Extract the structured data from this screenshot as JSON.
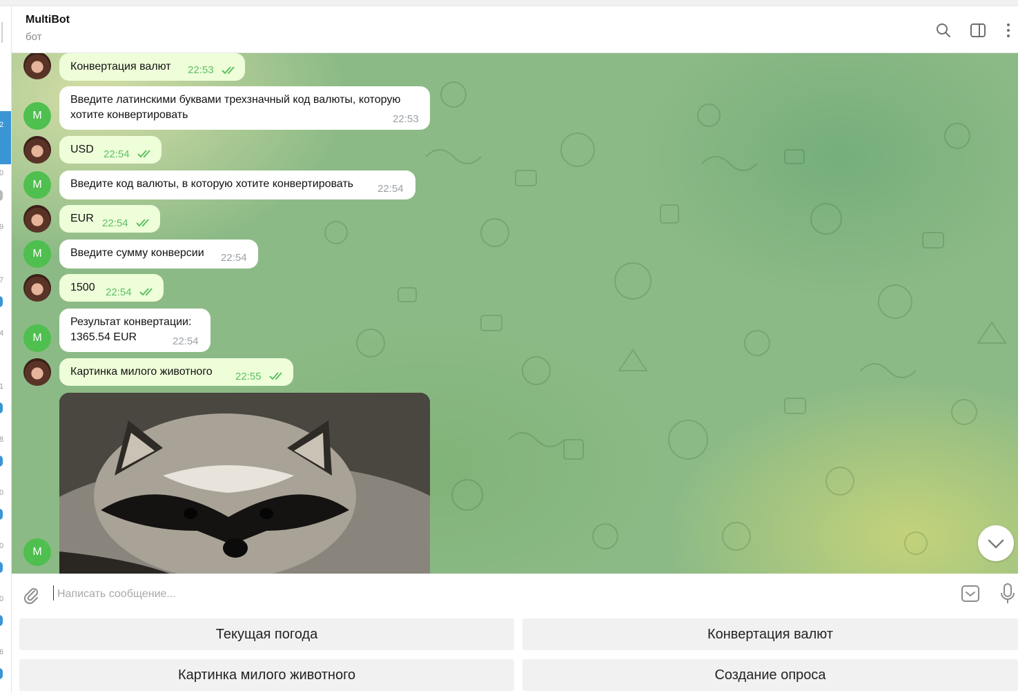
{
  "header": {
    "title": "MultiBot",
    "subtitle": "бот"
  },
  "left_strip": {
    "numbers": [
      "2",
      "0",
      "9",
      "7",
      "4",
      "1",
      "8",
      "0",
      "0",
      "0",
      "6"
    ]
  },
  "messages": [
    {
      "from": "user",
      "text": "Конвертация валют",
      "time": "22:53"
    },
    {
      "from": "bot",
      "avatar_letter": "M",
      "lines": [
        "Введите латинскими буквами трехзначный код валюты, которую",
        "хотите конвертировать"
      ],
      "time": "22:53"
    },
    {
      "from": "user",
      "text": "USD",
      "time": "22:54"
    },
    {
      "from": "bot",
      "avatar_letter": "M",
      "text": "Введите код валюты, в которую хотите конвертировать",
      "time": "22:54"
    },
    {
      "from": "user",
      "text": "EUR",
      "time": "22:54"
    },
    {
      "from": "bot",
      "avatar_letter": "M",
      "text": "Введите сумму конверсии",
      "time": "22:54"
    },
    {
      "from": "user",
      "text": "1500",
      "time": "22:54"
    },
    {
      "from": "bot",
      "avatar_letter": "M",
      "lines": [
        "Результат конвертации:",
        "1365.54 EUR"
      ],
      "time": "22:54"
    },
    {
      "from": "user",
      "text": "Картинка милого животного",
      "time": "22:55"
    },
    {
      "from": "bot",
      "avatar_letter": "M",
      "photo": "raccoon"
    }
  ],
  "composer": {
    "placeholder": "Написать сообщение..."
  },
  "keyboard": {
    "buttons": [
      "Текущая погода",
      "Конвертация валют",
      "Картинка милого животного",
      "Создание опроса"
    ]
  },
  "icons": {
    "search": "search-icon",
    "sidebar": "sidebar-toggle-icon",
    "more": "more-vertical-icon",
    "attach": "paperclip-icon",
    "commands": "bot-commands-icon",
    "mic": "microphone-icon",
    "scroll": "chevron-down-icon"
  },
  "colors": {
    "accent": "#3a95d5",
    "outgoing_bubble": "#eefed9",
    "read_check": "#5dbf62",
    "bot_avatar": "#4fbf4f"
  }
}
